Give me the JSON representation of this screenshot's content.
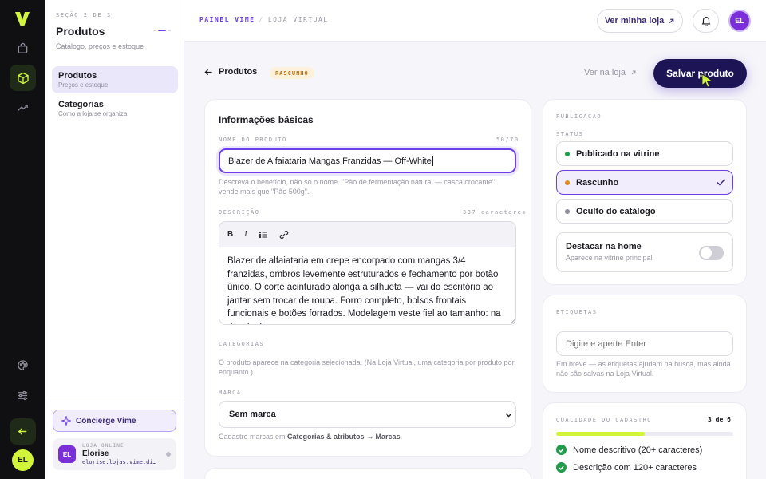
{
  "sidebar": {
    "kicker": "SEÇÃO 2 DE 3",
    "title": "Produtos",
    "subtitle": "Catálogo, preços e estoque",
    "items": [
      {
        "label": "Produtos",
        "desc": "Preços e estoque"
      },
      {
        "label": "Categorias",
        "desc": "Como a loja se organiza"
      }
    ],
    "concierge": "Concierge Vime",
    "store": {
      "kicker": "LOJA ONLINE",
      "initials": "EL",
      "name": "Elorise",
      "url": "elorise.lojas.vime.digital"
    }
  },
  "rail": {
    "avatar": "EL"
  },
  "topbar": {
    "crumb_app": "PAINEL VIME",
    "crumb_section": "LOJA VIRTUAL",
    "view_store": "Ver minha loja",
    "avatar": "EL"
  },
  "actions": {
    "back": "Produtos",
    "status_badge": "RASCUNHO",
    "view_in_store": "Ver na loja",
    "save": "Salvar produto"
  },
  "basic_info": {
    "title": "Informações básicas",
    "name_label": "NOME DO PRODUTO",
    "name_count": "50/70",
    "name_value": "Blazer de Alfaiataria Mangas Franzidas — Off-White",
    "name_hint": "Descreva o benefício, não só o nome. \"Pão de fermentação natural — casca crocante\" vende mais que \"Pão 500g\".",
    "desc_label": "DESCRIÇÃO",
    "desc_count": "337 caracteres",
    "desc_value": "Blazer de alfaiataria em crepe encorpado com mangas 3/4 franzidas, ombros levemente estruturados e fechamento por botão único. O corte acinturado alonga a silhueta — vai do escritório ao jantar sem trocar de roupa. Forro completo, bolsos frontais funcionais e botões forrados. Modelagem veste fiel ao tamanho: na dúvida, fique com o seu.",
    "toolbar": {
      "bold": "B",
      "italic": "I"
    },
    "cat_label": "CATEGORIAS",
    "cat_hint": "O produto aparece na categoria selecionada. (Na Loja Virtual, uma categoria por produto por enquanto.)",
    "brand_label": "MARCA",
    "brand_value": "Sem marca",
    "brand_hint_pre": "Cadastre marcas em ",
    "brand_hint_link": "Categorias & atributos → Marcas",
    "brand_hint_post": "."
  },
  "publication": {
    "label": "PUBLICAÇÃO",
    "status_label": "STATUS",
    "options": [
      {
        "label": "Publicado na vitrine",
        "color": "#1f9b4a"
      },
      {
        "label": "Rascunho",
        "color": "#e08a1e"
      },
      {
        "label": "Oculto do catálogo",
        "color": "#8d8b99"
      }
    ],
    "feature_title": "Destacar na home",
    "feature_desc": "Aparece na vitrine principal",
    "feature_on": false
  },
  "tags": {
    "label": "ETIQUETAS",
    "placeholder": "Digite e aperte Enter",
    "hint": "Em breve — as etiquetas ajudam na busca, mas ainda não são salvas na Loja Virtual."
  },
  "quality": {
    "label": "QUALIDADE DO CADASTRO",
    "score": "3 de 6",
    "progress": 0.5,
    "items": [
      "Nome descritivo (20+ caracteres)",
      "Descrição com 120+ caracteres"
    ]
  },
  "colors": {
    "accent": "#6b3ee6",
    "brand_lime": "#d2f53c",
    "dark": "#1d1456"
  }
}
